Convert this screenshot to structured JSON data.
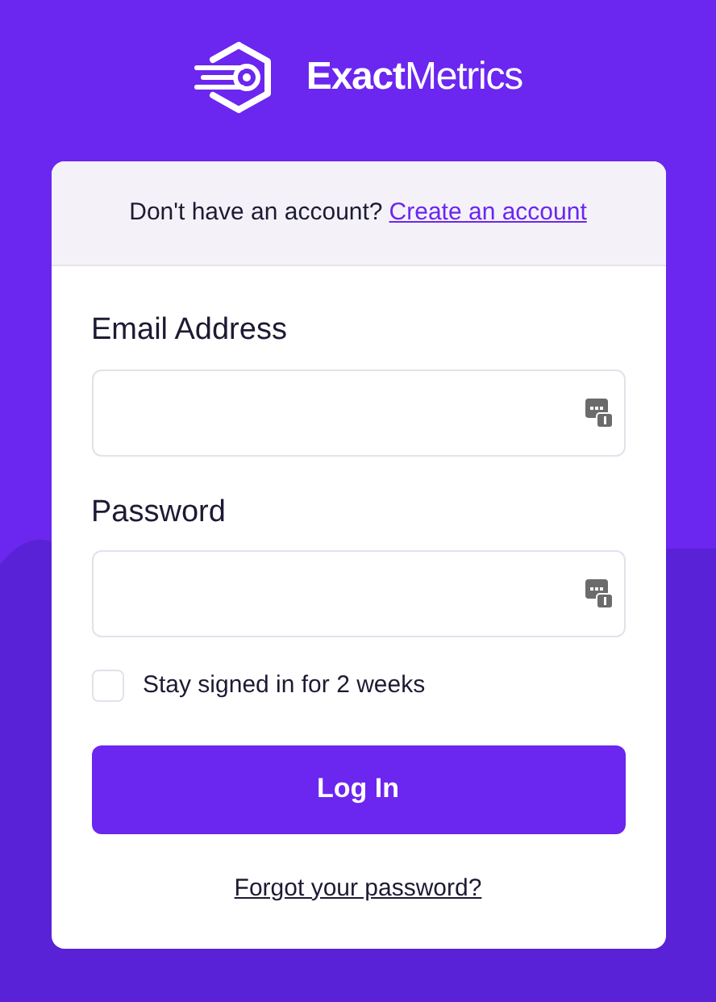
{
  "brand": {
    "name_bold": "Exact",
    "name_light": "Metrics"
  },
  "signup_prompt": {
    "text": "Don't have an account?",
    "link": "Create an account"
  },
  "fields": [
    {
      "label": "Email Address"
    },
    {
      "label": "Password"
    }
  ],
  "remember": {
    "label": "Stay signed in for 2 weeks",
    "checked": false
  },
  "submit": "Log In",
  "forgot_link": "Forgot your password?"
}
